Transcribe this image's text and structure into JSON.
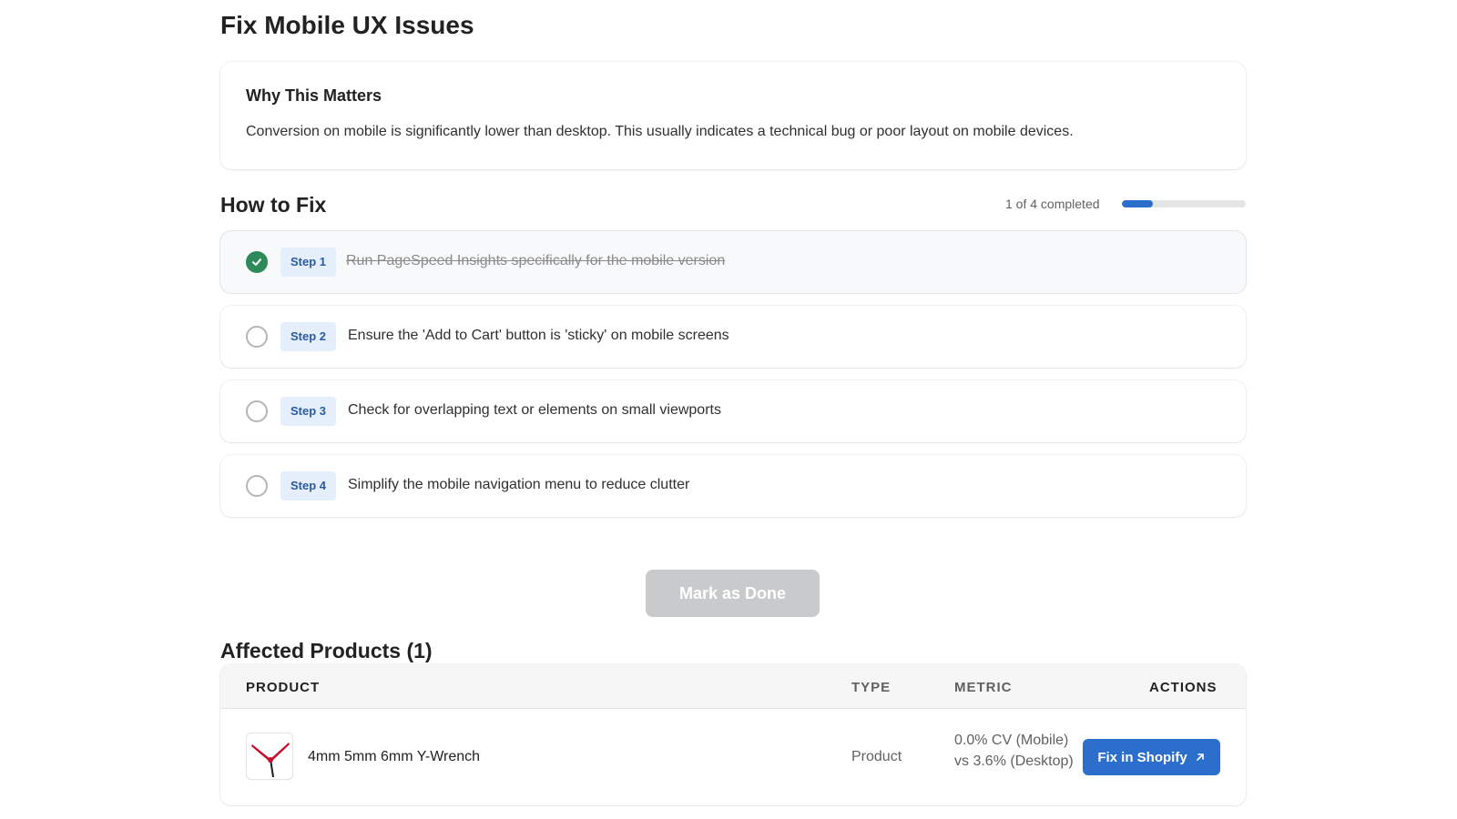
{
  "page": {
    "title": "Fix Mobile UX Issues"
  },
  "why": {
    "title": "Why This Matters",
    "body": "Conversion on mobile is significantly lower than desktop. This usually indicates a technical bug or poor layout on mobile devices."
  },
  "how_to_fix": {
    "title": "How to Fix",
    "progress_text": "1 of 4 completed",
    "progress_fraction": 0.25,
    "steps": [
      {
        "badge": "Step 1",
        "text": "Run PageSpeed Insights specifically for the mobile version",
        "completed": true
      },
      {
        "badge": "Step 2",
        "text": "Ensure the 'Add to Cart' button is 'sticky' on mobile screens",
        "completed": false
      },
      {
        "badge": "Step 3",
        "text": "Check for overlapping text or elements on small viewports",
        "completed": false
      },
      {
        "badge": "Step 4",
        "text": "Simplify the mobile navigation menu to reduce clutter",
        "completed": false
      }
    ]
  },
  "mark_done_label": "Mark as Done",
  "affected": {
    "title": "Affected Products (1)",
    "columns": {
      "product": "PRODUCT",
      "type": "TYPE",
      "metric": "METRIC",
      "actions": "ACTIONS"
    },
    "rows": [
      {
        "name": "4mm 5mm 6mm Y-Wrench",
        "type": "Product",
        "metric": "0.0% CV (Mobile) vs 3.6% (Desktop)",
        "action_label": "Fix in Shopify",
        "thumbnail_icon": "y-wrench-icon"
      }
    ]
  },
  "colors": {
    "accent": "#2c6ecb",
    "success": "#2f8a5a",
    "badge_bg": "#e4effb",
    "disabled_button": "#c8cacc"
  }
}
